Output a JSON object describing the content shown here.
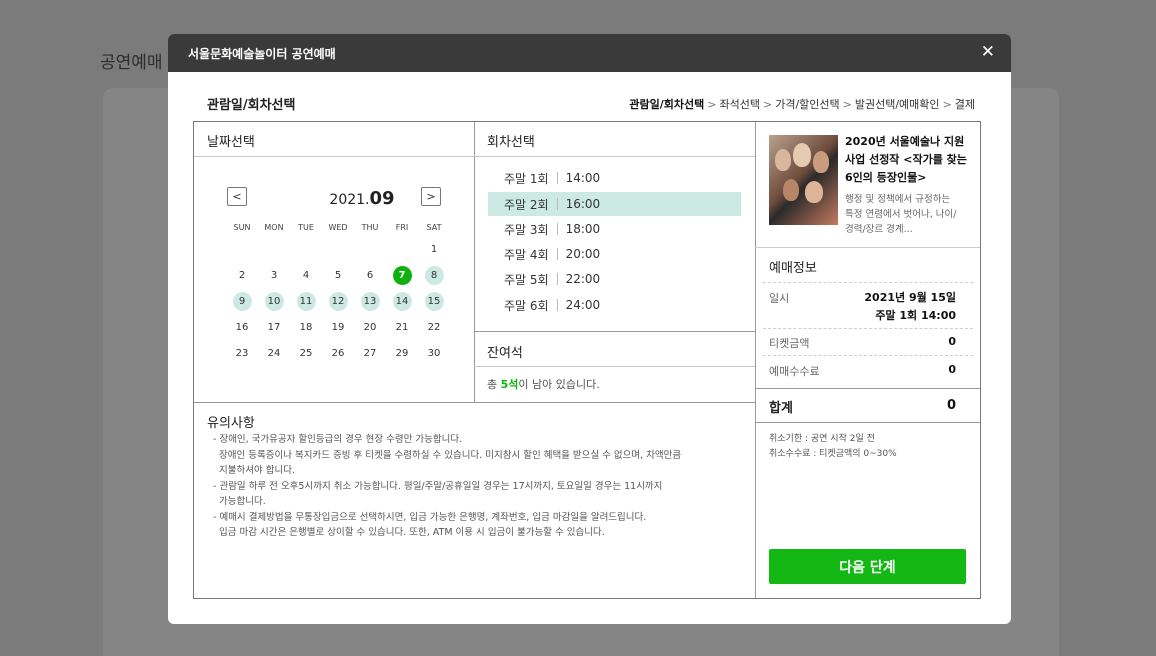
{
  "background": {
    "title": "공연예매"
  },
  "modal": {
    "title": "서울문화예술놀이터 공연예매",
    "close_symbol": "✕"
  },
  "step_title": "관람일/회차선택",
  "steps": [
    "관람일/회차선택",
    "좌석선택",
    "가격/할인선택",
    "발권선택/예매확인",
    "결제"
  ],
  "steps_separator": ">",
  "date_section": {
    "heading": "날짜선택",
    "year_label": "2021.",
    "month_label": "09",
    "prev_symbol": "<",
    "next_symbol": ">",
    "weekdays": [
      "SUN",
      "MON",
      "TUE",
      "WED",
      "THU",
      "FRI",
      "SAT"
    ],
    "weeks": [
      [
        "",
        "",
        "",
        "",
        "",
        "",
        "1"
      ],
      [
        "2",
        "3",
        "4",
        "5",
        "6",
        "7",
        "8"
      ],
      [
        "9",
        "10",
        "11",
        "12",
        "13",
        "14",
        "15"
      ],
      [
        "16",
        "17",
        "18",
        "19",
        "20",
        "21",
        "22"
      ],
      [
        "23",
        "24",
        "25",
        "26",
        "27",
        "29",
        "30"
      ]
    ],
    "selected_day": "7",
    "available_days": [
      "8",
      "9",
      "10",
      "11",
      "12",
      "13",
      "14",
      "15"
    ]
  },
  "session_section": {
    "heading": "회차선택",
    "sessions": [
      {
        "name": "주말 1회",
        "time": "14:00"
      },
      {
        "name": "주말 2회",
        "time": "16:00"
      },
      {
        "name": "주말 3회",
        "time": "18:00"
      },
      {
        "name": "주말 4회",
        "time": "20:00"
      },
      {
        "name": "주말 5회",
        "time": "22:00"
      },
      {
        "name": "주말 6회",
        "time": "24:00"
      }
    ],
    "active_index": 1
  },
  "remaining": {
    "heading": "잔여석",
    "prefix": "총 ",
    "count": "5석",
    "suffix": "이 남아 있습니다."
  },
  "show_info": {
    "title_lines": [
      "2020년 서울예술나 지원",
      "사업 선정작 <작가를 찾는",
      "6인의 등장인물>"
    ],
    "desc_lines": [
      "행정 및 정책에서 규정하는",
      "특정 연령에서 벗어나, 나이/",
      "경력/장르 경계..."
    ]
  },
  "booking": {
    "heading": "예매정보",
    "date_label": "일시",
    "date_value": "2021년 9월 15일",
    "session_value": "주말 1회 14:00",
    "ticket_label": "티켓금액",
    "ticket_value": "0",
    "fee_label": "예매수수료",
    "fee_value": "0",
    "total_label": "합계",
    "total_value": "0",
    "cancel_deadline": "취소기한 : 공연 시작 2일 전",
    "cancel_fee": "취소수수료 : 티켓금액의 0~30%"
  },
  "next_button": "다음 단계",
  "notes": {
    "heading": "유의사항",
    "lines": [
      "- 장애인, 국가유공자 할인등급의 경우 현장 수령만 가능합니다.",
      "",
      "  장애인 등록증이나 복지카드 증빙 후 티켓을 수령하실 수 있습니다. 미지참시 할인 혜택을 받으실 수 없으며, 차액만큼",
      "  지불하셔야 합니다.",
      "- 관람일 하루 전 오후5시까지 취소 가능합니다. 평일/주말/공휴일일 경우는 17시까지, 토요일일 경우는 11시까지",
      "  가능합니다.",
      "- 예매시 결제방법을 무통장입금으로 선택하시면, 입금 가능한 은행명, 계좌번호, 입금 마감일을 알려드립니다.",
      "",
      "  입금 마감 시간은 은행별로 상이할 수 있습니다. 또한, ATM 이용 시 입금이 불가능할 수 있습니다."
    ]
  }
}
